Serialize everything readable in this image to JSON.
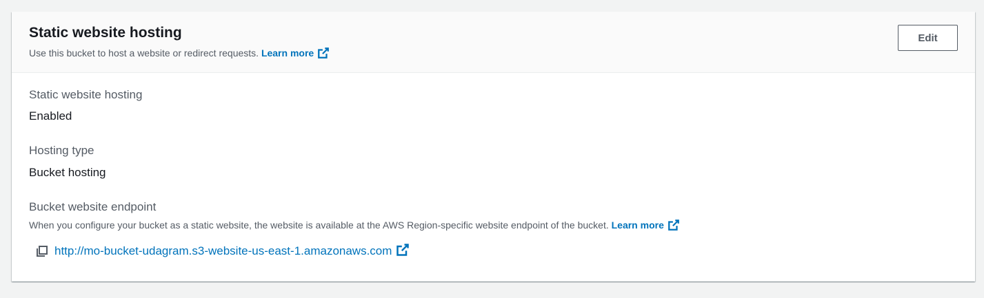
{
  "header": {
    "title": "Static website hosting",
    "description": "Use this bucket to host a website or redirect requests.",
    "learn_more": "Learn more",
    "edit_label": "Edit"
  },
  "fields": {
    "hosting": {
      "label": "Static website hosting",
      "value": "Enabled"
    },
    "hosting_type": {
      "label": "Hosting type",
      "value": "Bucket hosting"
    },
    "endpoint": {
      "label": "Bucket website endpoint",
      "description": "When you configure your bucket as a static website, the website is available at the AWS Region-specific website endpoint of the bucket.",
      "learn_more": "Learn more",
      "url": "http://mo-bucket-udagram.s3-website-us-east-1.amazonaws.com"
    }
  },
  "icons": {
    "external_link": "external-link-icon",
    "copy": "copy-icon"
  },
  "colors": {
    "link": "#0073bb",
    "text": "#16191f",
    "secondary_text": "#545b64",
    "header_bg": "#fafafa",
    "page_bg": "#f2f3f3"
  }
}
